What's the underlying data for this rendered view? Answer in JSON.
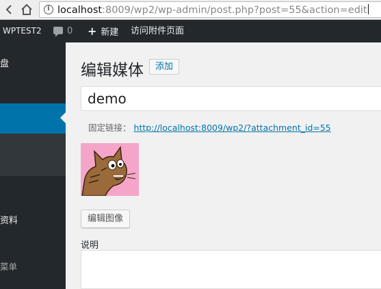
{
  "browser": {
    "url_host": "localhost",
    "url_rest": ":8009/wp2/wp-admin/post.php?post=55&action=edit"
  },
  "admin_bar": {
    "site_name": "WPTEST2",
    "comment_count": "0",
    "new_label": "新建",
    "view_attachment_label": "访问附件页面"
  },
  "sidebar": {
    "dashboard_label": "盘",
    "profile_label": "资料",
    "collapse_label": "菜单"
  },
  "main": {
    "page_title": "编辑媒体",
    "add_button_label": "添加",
    "title_value": "demo",
    "permalink_label": "固定链接：",
    "permalink_url": "http://localhost:8009/wp2/?attachment_id=55",
    "edit_image_button_label": "编辑图像",
    "description_label": "说明",
    "description_value": ""
  },
  "colors": {
    "admin_dark": "#23282d",
    "accent_blue": "#0073aa",
    "background": "#f1f1f1"
  }
}
